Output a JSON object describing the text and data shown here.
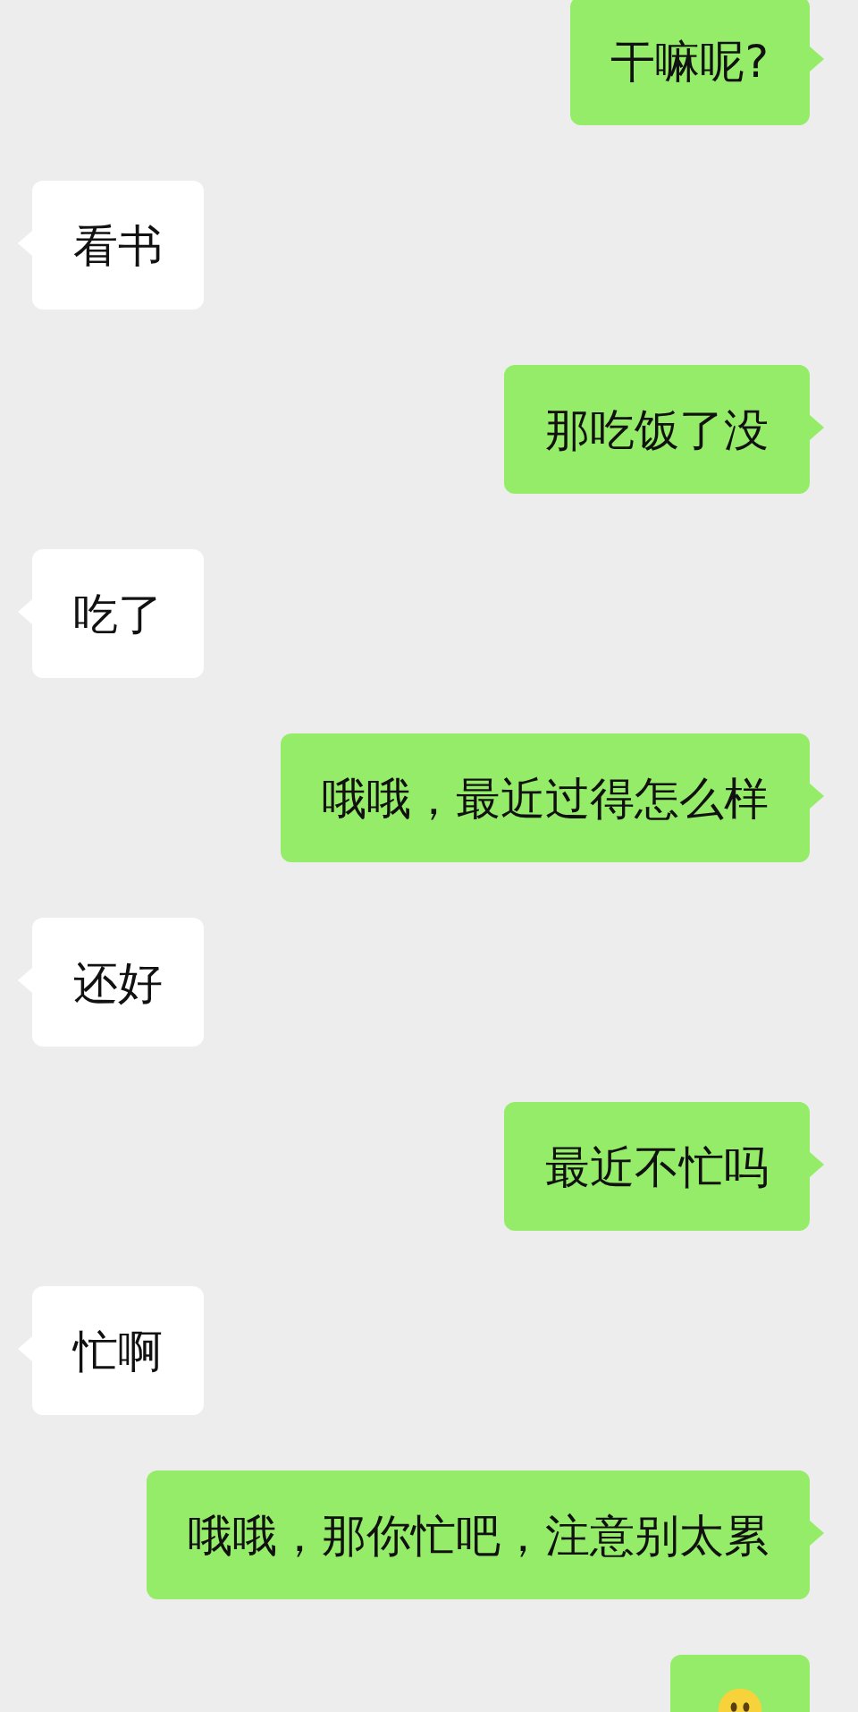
{
  "messages": [
    {
      "kind": "sent",
      "text": "干嘛呢?"
    },
    {
      "kind": "received",
      "text": "看书"
    },
    {
      "kind": "sent",
      "text": "那吃饭了没"
    },
    {
      "kind": "received",
      "text": "吃了"
    },
    {
      "kind": "sent",
      "text": "哦哦，最近过得怎么样"
    },
    {
      "kind": "received",
      "text": "还好"
    },
    {
      "kind": "sent",
      "text": "最近不忙吗"
    },
    {
      "kind": "received",
      "text": "忙啊"
    },
    {
      "kind": "sent",
      "text": "哦哦，那你忙吧，注意别太累"
    },
    {
      "kind": "sticker"
    }
  ]
}
